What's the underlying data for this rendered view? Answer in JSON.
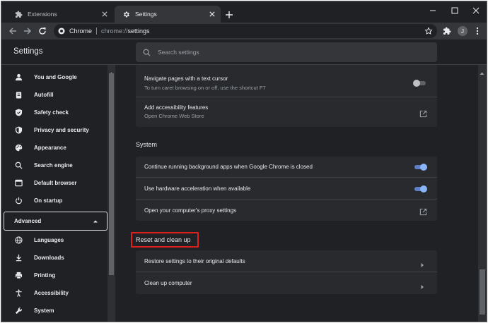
{
  "tabs": [
    {
      "label": "Extensions",
      "icon": "puzzle-icon"
    },
    {
      "label": "Settings",
      "icon": "gear-icon"
    }
  ],
  "omnibox": {
    "chip": "Chrome",
    "url_scheme": "chrome://",
    "url_host": "settings"
  },
  "profile": {
    "initial": "J"
  },
  "header": {
    "title": "Settings",
    "search_placeholder": "Search settings"
  },
  "sidebar": {
    "items": [
      {
        "label": "You and Google",
        "icon": "person-icon"
      },
      {
        "label": "Autofill",
        "icon": "clipboard-icon"
      },
      {
        "label": "Safety check",
        "icon": "shield-check-icon"
      },
      {
        "label": "Privacy and security",
        "icon": "shield-icon"
      },
      {
        "label": "Appearance",
        "icon": "palette-icon"
      },
      {
        "label": "Search engine",
        "icon": "search-icon"
      },
      {
        "label": "Default browser",
        "icon": "browser-icon"
      },
      {
        "label": "On startup",
        "icon": "power-icon"
      }
    ],
    "advanced_label": "Advanced",
    "advanced_items": [
      {
        "label": "Languages",
        "icon": "globe-icon"
      },
      {
        "label": "Downloads",
        "icon": "download-icon"
      },
      {
        "label": "Printing",
        "icon": "printer-icon"
      },
      {
        "label": "Accessibility",
        "icon": "accessibility-icon"
      },
      {
        "label": "System",
        "icon": "wrench-icon"
      }
    ]
  },
  "accessibility": {
    "caret_title": "Navigate pages with a text cursor",
    "caret_sub": "To turn caret browsing on or off, use the shortcut F7",
    "caret_on": false,
    "features_title": "Add accessibility features",
    "features_sub": "Open Chrome Web Store"
  },
  "system": {
    "title": "System",
    "bg_apps": "Continue running background apps when Google Chrome is closed",
    "bg_apps_on": true,
    "hw_accel": "Use hardware acceleration when available",
    "hw_accel_on": true,
    "proxy": "Open your computer's proxy settings"
  },
  "reset": {
    "title": "Reset and clean up",
    "restore": "Restore settings to their original defaults",
    "cleanup": "Clean up computer"
  },
  "colors": {
    "background": "#202124",
    "card": "#292a2d",
    "toggle_on": "#8ab4f8",
    "highlight_box": "#e0201e"
  }
}
